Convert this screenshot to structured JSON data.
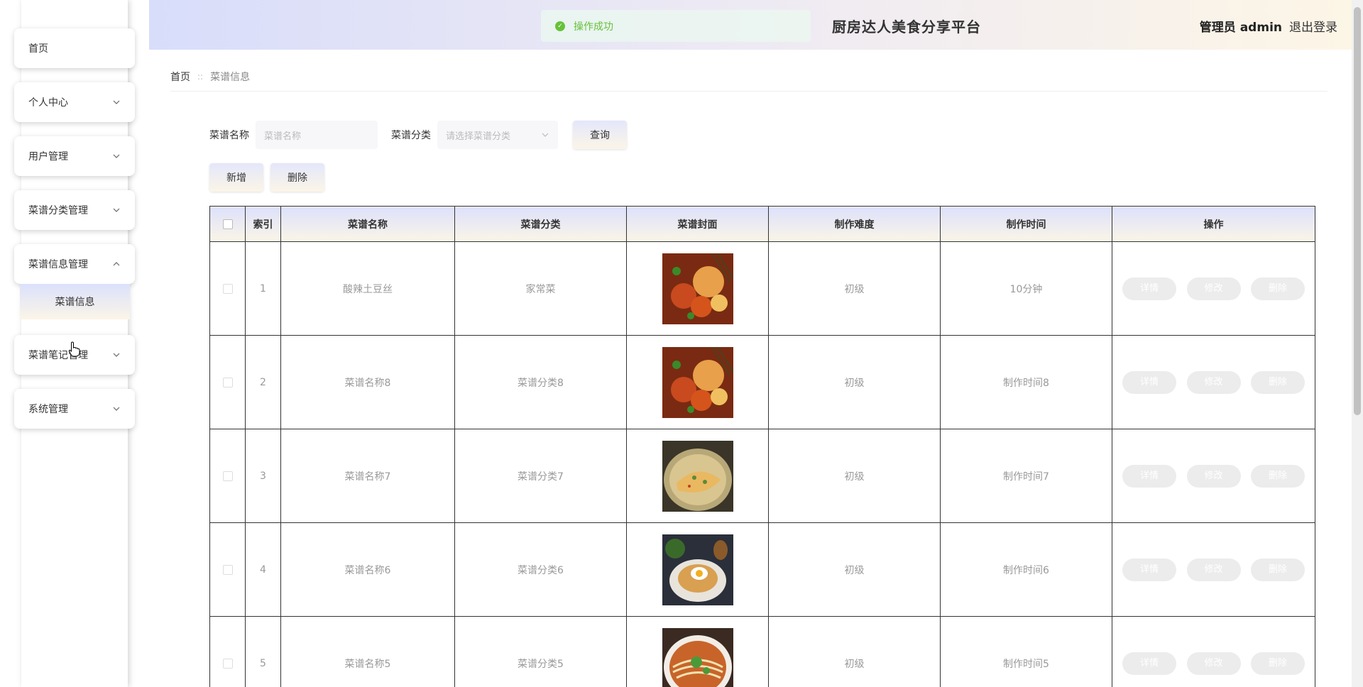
{
  "header": {
    "title": "厨房达人美食分享平台",
    "user_role": "管理员 admin",
    "logout": "退出登录"
  },
  "toast": {
    "message": "操作成功"
  },
  "sidebar": {
    "items": [
      {
        "label": "首页"
      },
      {
        "label": "个人中心"
      },
      {
        "label": "用户管理"
      },
      {
        "label": "菜谱分类管理"
      },
      {
        "label": "菜谱信息管理"
      },
      {
        "label": "菜谱笔记管理"
      },
      {
        "label": "系统管理"
      }
    ],
    "submenu": {
      "label": "菜谱信息"
    }
  },
  "breadcrumb": {
    "home": "首页",
    "separator": "::",
    "current": "菜谱信息"
  },
  "search": {
    "name_label": "菜谱名称",
    "name_placeholder": "菜谱名称",
    "category_label": "菜谱分类",
    "category_placeholder": "请选择菜谱分类",
    "query_button": "查询",
    "add_button": "新增",
    "delete_button": "删除"
  },
  "table": {
    "headers": [
      "索引",
      "菜谱名称",
      "菜谱分类",
      "菜谱封面",
      "制作难度",
      "制作时间",
      "操作"
    ],
    "actions": {
      "detail": "详情",
      "edit": "修改",
      "delete": "删除"
    },
    "rows": [
      {
        "index": "1",
        "name": "酸辣土豆丝",
        "category": "家常菜",
        "difficulty": "初级",
        "time": "10分钟",
        "cover": "food-photo-1"
      },
      {
        "index": "2",
        "name": "菜谱名称8",
        "category": "菜谱分类8",
        "difficulty": "初级",
        "time": "制作时间8",
        "cover": "food-photo-2"
      },
      {
        "index": "3",
        "name": "菜谱名称7",
        "category": "菜谱分类7",
        "difficulty": "初级",
        "time": "制作时间7",
        "cover": "food-photo-3"
      },
      {
        "index": "4",
        "name": "菜谱名称6",
        "category": "菜谱分类6",
        "difficulty": "初级",
        "time": "制作时间6",
        "cover": "food-photo-4"
      },
      {
        "index": "5",
        "name": "菜谱名称5",
        "category": "菜谱分类5",
        "difficulty": "初级",
        "time": "制作时间5",
        "cover": "food-photo-5"
      }
    ]
  },
  "colors": {
    "accent_gradient_start": "#d8ddfa",
    "accent_gradient_end": "#fdf6e6",
    "success": "#67c23a"
  }
}
